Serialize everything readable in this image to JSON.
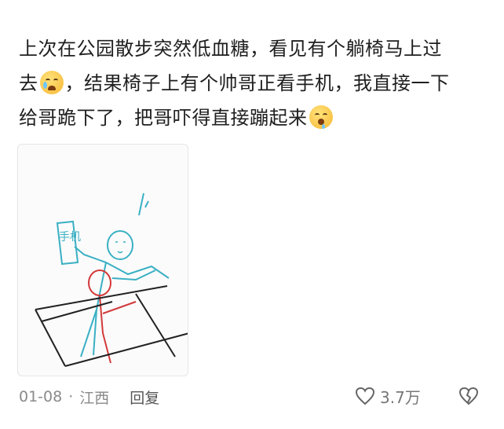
{
  "comment": {
    "lines": [
      {
        "text_a": "上次在公园散步突然低血糖，看见有个躺椅马上过",
        "text_b": ""
      },
      {
        "text_a": "去",
        "text_b": "，结果椅子上有个帅哥正看手机，我直接一下"
      },
      {
        "text_a": "给哥跪下了，把哥吓得直接蹦起来",
        "text_b": ""
      }
    ],
    "emoji_1": "crying-face-emoji",
    "emoji_2": "drooling-face-emoji",
    "drawing_label": "手机"
  },
  "meta": {
    "date": "01-08",
    "separator": "·",
    "location": "江西",
    "reply_label": "回复"
  },
  "actions": {
    "like_count": "3.7万",
    "like_icon": "heart-icon",
    "dislike_icon": "broken-heart-icon"
  },
  "colors": {
    "text": "#1f1f1f",
    "meta": "#8a8a8a",
    "sketch_black": "#222222",
    "sketch_teal": "#3ab0c4",
    "sketch_red": "#d23a3a"
  }
}
